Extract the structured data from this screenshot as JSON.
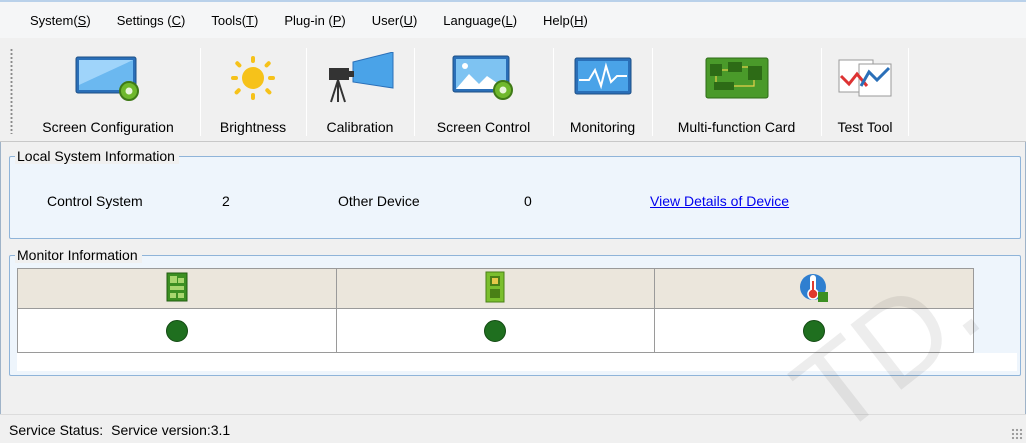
{
  "menu": [
    {
      "text": "System(",
      "accel": "S",
      "tail": ")"
    },
    {
      "text": "Settings (",
      "accel": "C",
      "tail": ")"
    },
    {
      "text": "Tools(",
      "accel": "T",
      "tail": ")"
    },
    {
      "text": "Plug-in (",
      "accel": "P",
      "tail": ")"
    },
    {
      "text": "User(",
      "accel": "U",
      "tail": ")"
    },
    {
      "text": "Language(",
      "accel": "L",
      "tail": ")"
    },
    {
      "text": "Help(",
      "accel": "H",
      "tail": ")"
    }
  ],
  "toolbar": [
    {
      "label": "Screen Configuration",
      "icon": "screen-configuration-icon"
    },
    {
      "label": "Brightness",
      "icon": "sun-icon"
    },
    {
      "label": "Calibration",
      "icon": "camera-icon"
    },
    {
      "label": "Screen Control",
      "icon": "screen-control-icon"
    },
    {
      "label": "Monitoring",
      "icon": "monitoring-icon"
    },
    {
      "label": "Multi-function Card",
      "icon": "circuit-card-icon"
    },
    {
      "label": "Test Tool",
      "icon": "test-chart-icon"
    }
  ],
  "local_system": {
    "title": "Local System Information",
    "control_system_label": "Control System",
    "control_system_count": "2",
    "other_device_label": "Other Device",
    "other_device_count": "0",
    "details_link": "View Details of Device"
  },
  "monitor": {
    "title": "Monitor Information",
    "columns": [
      {
        "icon": "sending-card-icon",
        "status": "ok"
      },
      {
        "icon": "receiving-card-icon",
        "status": "ok"
      },
      {
        "icon": "thermometer-icon",
        "status": "ok"
      }
    ],
    "status_color": "#1f6f1f"
  },
  "status_bar": {
    "label": "Service Status:",
    "version": "Service version:3.1"
  },
  "watermark": "TD."
}
